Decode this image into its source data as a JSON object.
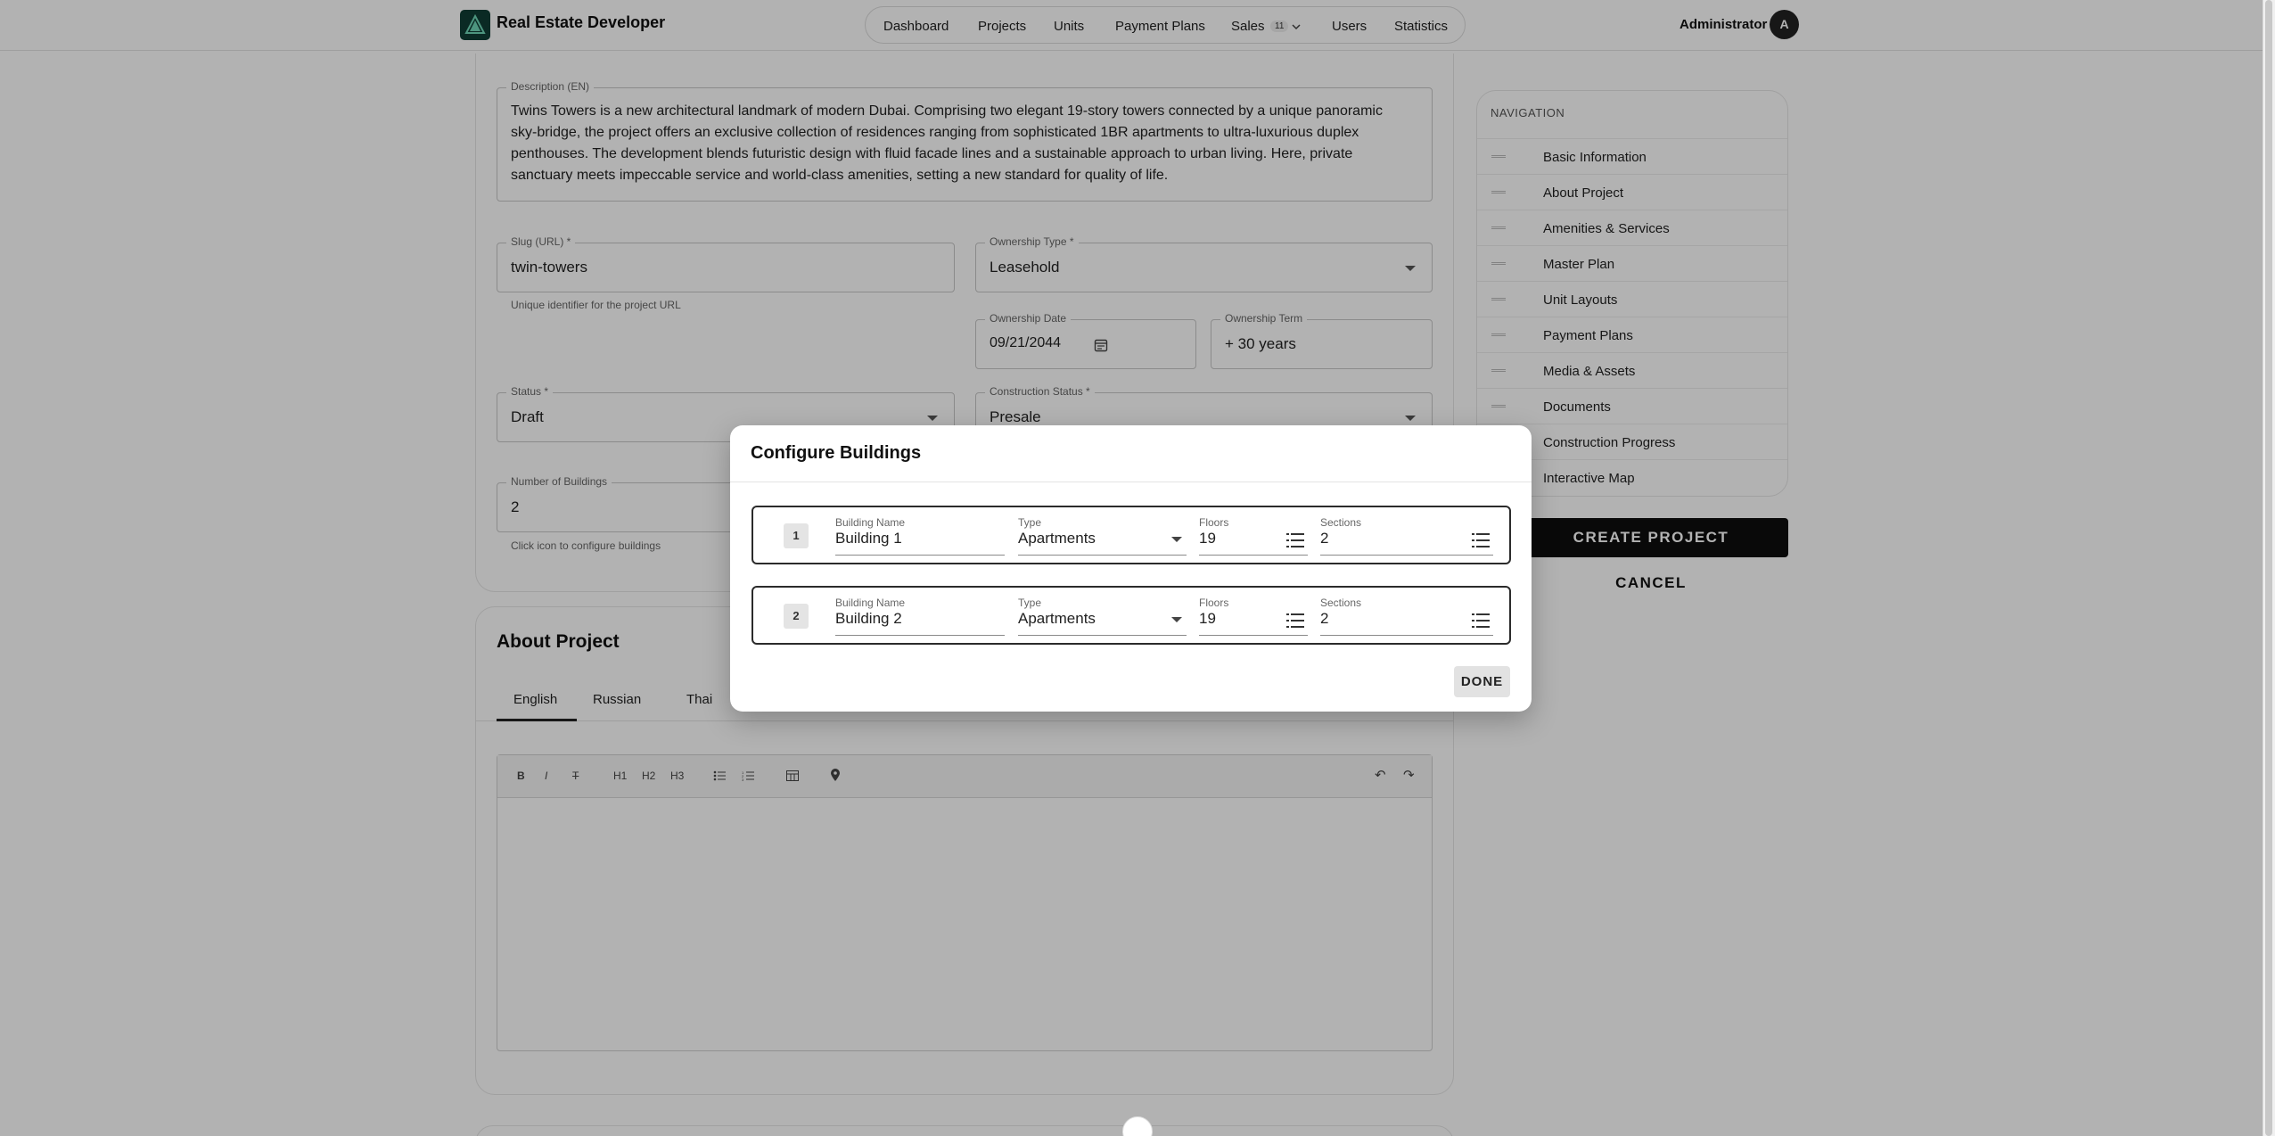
{
  "header": {
    "brand": "Real Estate Developer",
    "nav": [
      {
        "label": "Dashboard"
      },
      {
        "label": "Projects"
      },
      {
        "label": "Units"
      },
      {
        "label": "Payment Plans"
      },
      {
        "label": "Sales",
        "badge": "11"
      },
      {
        "label": "Users"
      },
      {
        "label": "Statistics"
      }
    ],
    "user_name": "Administrator",
    "avatar_initial": "A"
  },
  "form": {
    "description": {
      "label": "Description (EN)",
      "value": "Twins Towers is a new architectural landmark of modern Dubai. Comprising two elegant 19-story towers connected by a unique panoramic sky-bridge, the project offers an exclusive collection of residences ranging from sophisticated 1BR apartments to ultra-luxurious duplex penthouses. The development blends futuristic design with fluid facade lines and a sustainable approach to urban living. Here, private sanctuary meets impeccable service and world-class amenities, setting a new standard for quality of life."
    },
    "slug": {
      "label": "Slug (URL) *",
      "value": "twin-towers",
      "helper": "Unique identifier for the project URL"
    },
    "ownership_type": {
      "label": "Ownership Type *",
      "value": "Leasehold"
    },
    "ownership_date": {
      "label": "Ownership Date",
      "value": "09/21/2044"
    },
    "ownership_term": {
      "label": "Ownership Term",
      "value": "+ 30 years"
    },
    "status": {
      "label": "Status *",
      "value": "Draft"
    },
    "construction_status": {
      "label": "Construction Status *",
      "value": "Presale"
    },
    "number_of_buildings": {
      "label": "Number of Buildings",
      "value": "2",
      "helper": "Click icon to configure buildings"
    }
  },
  "about": {
    "title": "About Project",
    "tabs": [
      "English",
      "Russian",
      "Thai"
    ],
    "toolbar": {
      "bold": "B",
      "italic": "I",
      "strike": "T",
      "h1": "H1",
      "h2": "H2",
      "h3": "H3",
      "undo": "↶",
      "redo": "↷"
    }
  },
  "sidebar": {
    "title": "NAVIGATION",
    "items": [
      "Basic Information",
      "About Project",
      "Amenities & Services",
      "Master Plan",
      "Unit Layouts",
      "Payment Plans",
      "Media & Assets",
      "Documents",
      "Construction Progress",
      "Interactive Map"
    ],
    "create_label": "CREATE PROJECT",
    "cancel_label": "CANCEL"
  },
  "modal": {
    "title": "Configure Buildings",
    "labels": {
      "name": "Building Name",
      "type": "Type",
      "floors": "Floors",
      "sections": "Sections"
    },
    "buildings": [
      {
        "number": "1",
        "name": "Building 1",
        "type": "Apartments",
        "floors": "19",
        "sections": "2"
      },
      {
        "number": "2",
        "name": "Building 2",
        "type": "Apartments",
        "floors": "19",
        "sections": "2"
      }
    ],
    "done_label": "DONE"
  },
  "icons": [
    "logo-icon",
    "calendar-icon",
    "dropdown-arrow-icon",
    "list-icon",
    "drag-handle-icon",
    "map-pin-icon",
    "table-icon",
    "undo-icon",
    "redo-icon",
    "chevron-down-icon"
  ]
}
